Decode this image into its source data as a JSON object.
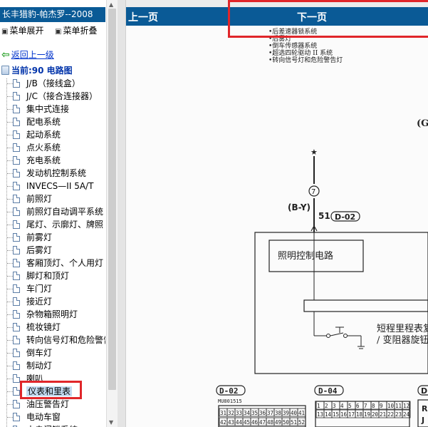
{
  "app": {
    "title": "长丰猎豹-帕杰罗--2008"
  },
  "menu": {
    "expand_label": "菜单展开",
    "collapse_label": "菜单折叠"
  },
  "back": {
    "label": "返回上一级"
  },
  "current": {
    "label": "当前:90 电路图"
  },
  "tree": {
    "items": [
      {
        "label": "J/B（接线盒）"
      },
      {
        "label": "J/C（接合连接器）"
      },
      {
        "label": "集中式连接"
      },
      {
        "label": "配电系统"
      },
      {
        "label": "起动系统"
      },
      {
        "label": "点火系统"
      },
      {
        "label": "充电系统"
      },
      {
        "label": "发动机控制系统"
      },
      {
        "label": "INVECS—II 5A/T"
      },
      {
        "label": "前照灯"
      },
      {
        "label": "前照灯自动调平系统"
      },
      {
        "label": "尾灯、示廓灯、牌照"
      },
      {
        "label": "前雾灯"
      },
      {
        "label": "后雾灯"
      },
      {
        "label": "客厢顶灯、个人用灯"
      },
      {
        "label": "脚灯和顶灯"
      },
      {
        "label": "车门灯"
      },
      {
        "label": "接近灯"
      },
      {
        "label": "杂物箱照明灯"
      },
      {
        "label": "梳妆镜灯"
      },
      {
        "label": "转向信号灯和危险警告"
      },
      {
        "label": "倒车灯"
      },
      {
        "label": "制动灯"
      },
      {
        "label": "喇叭"
      },
      {
        "label": "仪表和里表",
        "selected": true
      },
      {
        "label": "油压警告灯"
      },
      {
        "label": "电动车窗"
      },
      {
        "label": "中央门锁系统"
      }
    ]
  },
  "nav": {
    "prev_label": "上一页",
    "next_label": "下一页"
  },
  "diagram": {
    "systems": [
      "•后差速器锁系统",
      "•后雾灯",
      "•倒车传感器系统",
      "•超选四轮驱动 II 系统",
      "•转向信号灯和危险警告灯"
    ],
    "corner_label": "(G",
    "star": "★",
    "circle_num": "7",
    "wire_color": "(B-Y)",
    "pin": "51",
    "conn_main": "D-02",
    "box_label": "照明控制电路",
    "meter_label_1": "短程里程表复",
    "meter_label_2": "/ 变阻器旋钮",
    "conn_a": "D-02",
    "conn_a_part": "MU801515",
    "conn_a_row1": [
      "31",
      "32",
      "33",
      "34",
      "35",
      "36",
      "37",
      "38",
      "39",
      "40",
      "41"
    ],
    "conn_a_row2": [
      "42",
      "43",
      "44",
      "45",
      "46",
      "47",
      "48",
      "49",
      "50",
      "51",
      "52"
    ],
    "conn_b": "D-04",
    "conn_b_row1": [
      "13",
      "14",
      "15",
      "16",
      "17",
      "18",
      "19",
      "20",
      "21",
      "22",
      "23",
      "24"
    ],
    "conn_b_row0": [
      "1",
      "2",
      "3",
      "4",
      "5",
      "6",
      "7",
      "8",
      "9",
      "10",
      "11",
      "12"
    ],
    "conn_c": "D-",
    "conn_c_text": "R",
    "conn_c_text2": "J"
  }
}
